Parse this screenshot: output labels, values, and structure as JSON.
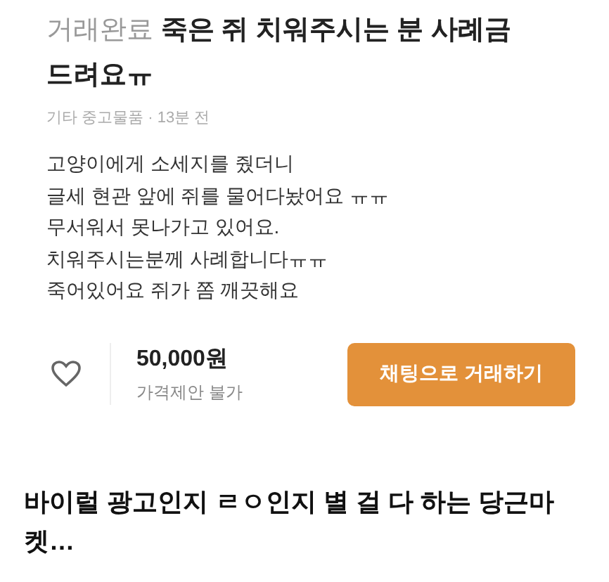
{
  "listing": {
    "status": "거래완료",
    "title": "죽은 쥐 치워주시는 분 사례금 드려요ㅠ",
    "meta": "기타 중고물품 · 13분 전",
    "body": [
      "고양이에게 소세지를 줬더니",
      "글세 현관 앞에 쥐를 물어다놨어요 ㅠㅠ",
      "무서워서 못나가고 있어요.",
      "치워주시는분께 사례합니다ㅠㅠ",
      "죽어있어요 쥐가 쫌 깨끗해요"
    ]
  },
  "bottom_bar": {
    "liked": false,
    "price": "50,000원",
    "price_note": "가격제안 불가",
    "button": "채팅으로 거래하기"
  },
  "caption": "바이럴 광고인지 ㄹㅇ인지 별 걸 다 하는 당근마켓…"
}
